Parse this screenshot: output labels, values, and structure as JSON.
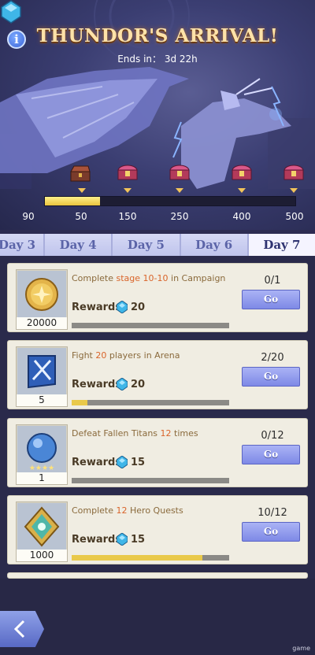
{
  "event": {
    "title": "THUNDOR'S ARRIVAL!",
    "ends_in_label": "Ends in： 3d 22h"
  },
  "progress": {
    "current_points": "90",
    "fill_fraction": 0.22,
    "milestones": [
      "50",
      "150",
      "250",
      "400",
      "500"
    ]
  },
  "tabs": [
    {
      "label": "Day 3",
      "active": false
    },
    {
      "label": "Day 4",
      "active": false
    },
    {
      "label": "Day 5",
      "active": false
    },
    {
      "label": "Day 6",
      "active": false
    },
    {
      "label": "Day 7",
      "active": true
    }
  ],
  "quests": [
    {
      "icon": "gold-coin-icon",
      "item_count": "20000",
      "task_prefix": "Complete ",
      "task_highlight": "stage 10-10",
      "task_suffix": " in Campaign",
      "rewards_label": "Rewards",
      "reward_value": "20",
      "progress_text": "0/1",
      "progress_fraction": 0,
      "button_label": "Go"
    },
    {
      "icon": "arena-scroll-icon",
      "item_count": "5",
      "task_prefix": "Fight ",
      "task_highlight": "20",
      "task_suffix": " players in Arena",
      "rewards_label": "Rewards",
      "reward_value": "20",
      "progress_text": "2/20",
      "progress_fraction": 0.1,
      "button_label": "Go"
    },
    {
      "icon": "blue-orb-icon",
      "item_count": "1",
      "task_prefix": "Defeat Fallen Titans ",
      "task_highlight": "12",
      "task_suffix": " times",
      "rewards_label": "Rewards",
      "reward_value": "15",
      "progress_text": "0/12",
      "progress_fraction": 0,
      "button_label": "Go"
    },
    {
      "icon": "hero-emblem-icon",
      "item_count": "1000",
      "task_prefix": "Complete ",
      "task_highlight": "12",
      "task_suffix": " Hero Quests",
      "rewards_label": "Rewards",
      "reward_value": "15",
      "progress_text": "10/12",
      "progress_fraction": 0.83,
      "button_label": "Go"
    }
  ],
  "watermark": "game",
  "colors": {
    "title": "#ffe2a8",
    "progress_fill": "#e9c43e",
    "button": "#7e89e6",
    "highlight": "#d9642a"
  }
}
